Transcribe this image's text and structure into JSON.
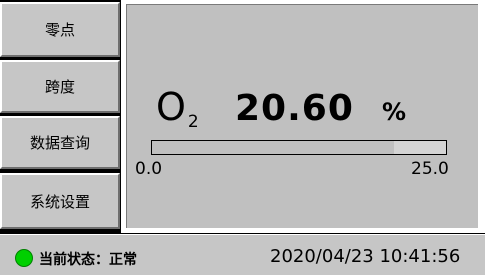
{
  "sidebar": {
    "items": [
      {
        "label": "零点"
      },
      {
        "label": "跨度"
      },
      {
        "label": "数据查询"
      },
      {
        "label": "系统设置"
      }
    ]
  },
  "main": {
    "gas_name": "O",
    "gas_subscript": "2",
    "reading": "20.60",
    "unit": "%",
    "range_min": "0.0",
    "range_max": "25.0",
    "bar_fill_fraction": 0.824
  },
  "status": {
    "label": "当前状态：正常",
    "indicator_color": "#00d000",
    "datetime": "2020/04/23 10:41:56"
  }
}
